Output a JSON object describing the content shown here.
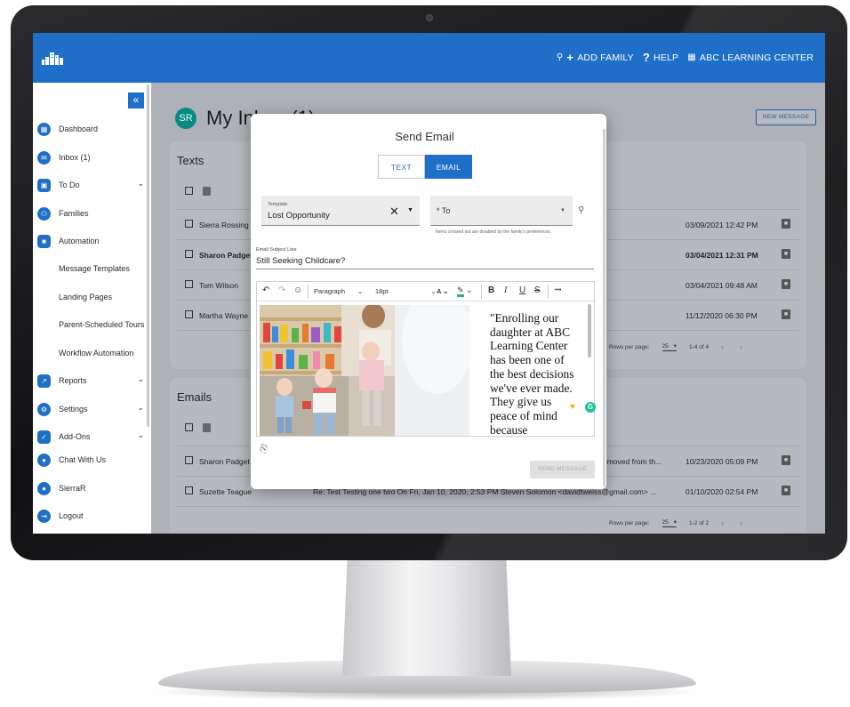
{
  "header": {
    "logo_icon": "buildings-logo-icon",
    "add_family_label": "ADD FAMILY",
    "help_label": "HELP",
    "center_name": "ABC LEARNING CENTER"
  },
  "sidebar": {
    "collapse_glyph": "«",
    "items": [
      {
        "label": "Dashboard",
        "icon": "dashboard-icon"
      },
      {
        "label": "Inbox (1)",
        "icon": "mail-icon"
      },
      {
        "label": "To Do",
        "icon": "todo-icon"
      },
      {
        "label": "Families",
        "icon": "families-icon"
      },
      {
        "label": "Automation",
        "icon": "briefcase-icon"
      },
      {
        "label": "Message Templates"
      },
      {
        "label": "Landing Pages"
      },
      {
        "label": "Parent-Scheduled Tours"
      },
      {
        "label": "Workflow Automation"
      },
      {
        "label": "Reports",
        "icon": "chart-icon"
      },
      {
        "label": "Settings",
        "icon": "settings-icon"
      },
      {
        "label": "Add-Ons",
        "icon": "addons-icon"
      },
      {
        "label": "Chat With Us",
        "icon": "chat-icon"
      },
      {
        "label": "SierraR",
        "icon": "user-icon"
      },
      {
        "label": "Logout",
        "icon": "logout-icon"
      }
    ]
  },
  "main": {
    "avatar_initials": "SR",
    "page_title": "My Inbox (1)",
    "new_message_label": "NEW MESSAGE",
    "texts_title": "Texts",
    "texts_rows": [
      {
        "name": "Sierra Rossing",
        "date": "03/09/2021 12:42 PM"
      },
      {
        "name": "Sharon Padget",
        "date": "03/04/2021 12:31 PM"
      },
      {
        "name": "Tom Wilson",
        "date": "03/04/2021 09:48 AM"
      },
      {
        "name": "Martha Wayne",
        "date": "11/12/2020 06:30 PM"
      }
    ],
    "texts_pager": {
      "label": "Rows per page:",
      "value": "25",
      "range": "1-4 of 4"
    },
    "emails_title": "Emails",
    "emails_rows": [
      {
        "name": "Sharon Padget",
        "snippet": "emoved from th...",
        "date": "10/23/2020 05:09 PM"
      },
      {
        "name": "Suzette Teague",
        "snippet": "Re: Test Testing one two On Fri, Jan 10, 2020, 2:53 PM Steven Solomon <davidtweiss@gmail.com> ...",
        "date": "01/10/2020 02:54 PM"
      }
    ],
    "emails_pager": {
      "label": "Rows per page:",
      "value": "25",
      "range": "1-2 of 2"
    }
  },
  "modal": {
    "title": "Send Email",
    "tab_text": "TEXT",
    "tab_email": "EMAIL",
    "template_label": "Template",
    "template_value": "Lost Opportunity",
    "to_placeholder": "* To",
    "to_hint": "Items crossed out are disabled by the family's preferences.",
    "subject_label": "Email Subject Line",
    "subject_value": "Still Seeking Childcare?",
    "toolbar": {
      "paragraph": "Paragraph",
      "font_size": "18pt",
      "font_color": "A",
      "bold": "B",
      "italic": "I",
      "underline": "U",
      "strike": "S",
      "more": "•••"
    },
    "body_text": "\"Enrolling our daughter at ABC Learning Center has been one of the best decisions we've ever made. They give us peace of mind because",
    "send_label": "SEND MESSAGE"
  },
  "colors": {
    "brand_blue": "#1f6fc9",
    "teal_avatar": "#0b8a84",
    "grammarly_green": "#15c39a"
  }
}
